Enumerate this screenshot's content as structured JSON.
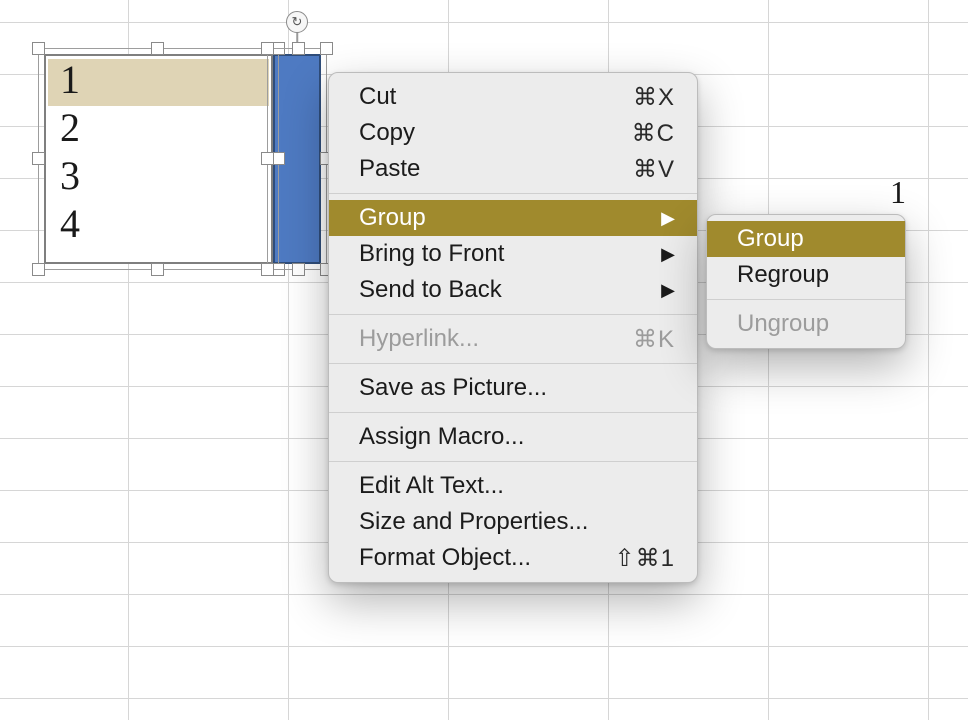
{
  "textbox_numbers": [
    "1",
    "2",
    "3",
    "4"
  ],
  "floating_cell_value": "1",
  "context_menu": {
    "cut": {
      "label": "Cut",
      "shortcut": "⌘X"
    },
    "copy": {
      "label": "Copy",
      "shortcut": "⌘C"
    },
    "paste": {
      "label": "Paste",
      "shortcut": "⌘V"
    },
    "group": {
      "label": "Group"
    },
    "bring_to_front": {
      "label": "Bring to Front"
    },
    "send_to_back": {
      "label": "Send to Back"
    },
    "hyperlink": {
      "label": "Hyperlink...",
      "shortcut": "⌘K"
    },
    "save_as_picture": {
      "label": "Save as Picture..."
    },
    "assign_macro": {
      "label": "Assign Macro..."
    },
    "edit_alt_text": {
      "label": "Edit Alt Text..."
    },
    "size_properties": {
      "label": "Size and Properties..."
    },
    "format_object": {
      "label": "Format Object...",
      "shortcut": "⇧⌘1"
    }
  },
  "submenu": {
    "group": {
      "label": "Group"
    },
    "regroup": {
      "label": "Regroup"
    },
    "ungroup": {
      "label": "Ungroup"
    }
  }
}
